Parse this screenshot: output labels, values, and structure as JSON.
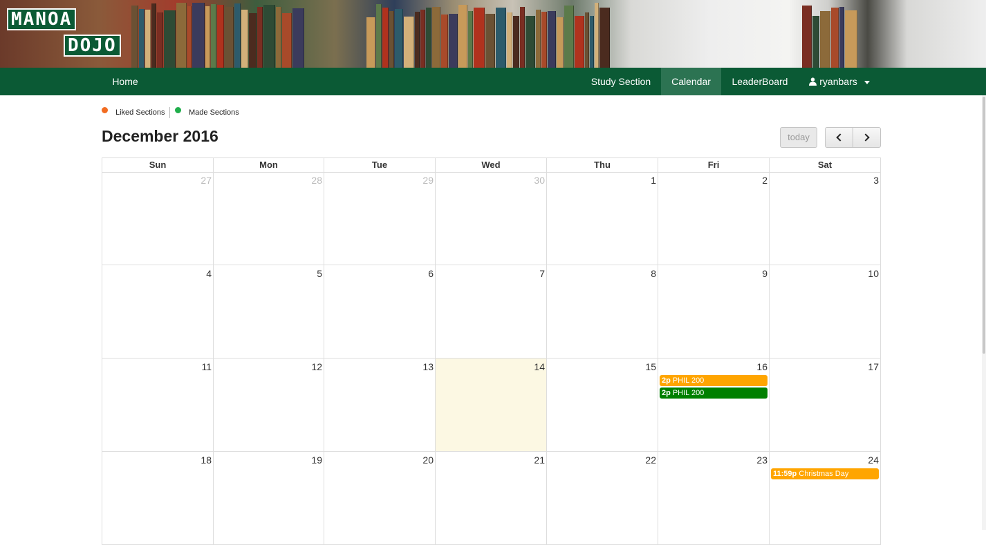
{
  "logo": {
    "line1": "MANOA",
    "line2": "DOJO"
  },
  "nav": {
    "home": "Home",
    "study_section": "Study Section",
    "calendar": "Calendar",
    "leaderboard": "LeaderBoard",
    "user": "ryanbars"
  },
  "legend": {
    "liked": {
      "label": "Liked Sections",
      "color": "#f26c21"
    },
    "made": {
      "label": "Made Sections",
      "color": "#1fae4b"
    }
  },
  "toolbar": {
    "title": "December 2016",
    "today": "today"
  },
  "weekdays": [
    "Sun",
    "Mon",
    "Tue",
    "Wed",
    "Thu",
    "Fri",
    "Sat"
  ],
  "weeks": [
    [
      {
        "n": "27",
        "other": true
      },
      {
        "n": "28",
        "other": true
      },
      {
        "n": "29",
        "other": true
      },
      {
        "n": "30",
        "other": true
      },
      {
        "n": "1"
      },
      {
        "n": "2"
      },
      {
        "n": "3"
      }
    ],
    [
      {
        "n": "4"
      },
      {
        "n": "5"
      },
      {
        "n": "6"
      },
      {
        "n": "7"
      },
      {
        "n": "8"
      },
      {
        "n": "9"
      },
      {
        "n": "10"
      }
    ],
    [
      {
        "n": "11"
      },
      {
        "n": "12"
      },
      {
        "n": "13"
      },
      {
        "n": "14",
        "today": true
      },
      {
        "n": "15"
      },
      {
        "n": "16",
        "events": [
          {
            "time": "2p",
            "title": "PHIL 200",
            "color": "#ffa500"
          },
          {
            "time": "2p",
            "title": "PHIL 200",
            "color": "#008000"
          }
        ]
      },
      {
        "n": "17"
      }
    ],
    [
      {
        "n": "18"
      },
      {
        "n": "19"
      },
      {
        "n": "20"
      },
      {
        "n": "21"
      },
      {
        "n": "22"
      },
      {
        "n": "23"
      },
      {
        "n": "24",
        "events": [
          {
            "time": "11:59p",
            "title": "Christmas Day",
            "color": "#ffa500"
          }
        ]
      }
    ]
  ]
}
